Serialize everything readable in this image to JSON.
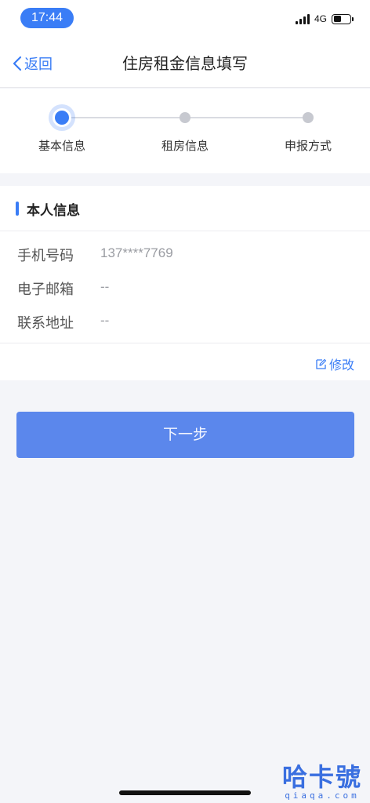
{
  "status_bar": {
    "time": "17:44",
    "network": "4G"
  },
  "nav": {
    "back_label": "返回",
    "title": "住房租金信息填写"
  },
  "steps": [
    {
      "label": "基本信息",
      "active": true
    },
    {
      "label": "租房信息",
      "active": false
    },
    {
      "label": "申报方式",
      "active": false
    }
  ],
  "section": {
    "title": "本人信息"
  },
  "fields": [
    {
      "label": "手机号码",
      "value": "137****7769"
    },
    {
      "label": "电子邮箱",
      "value": "--"
    },
    {
      "label": "联系地址",
      "value": "--"
    }
  ],
  "edit_label": "修改",
  "next_label": "下一步",
  "watermark": {
    "main": "哈卡號",
    "sub": "qiaqa.com"
  },
  "colors": {
    "accent": "#3a7df6",
    "button": "#5b87ec",
    "background": "#f4f5f9"
  }
}
